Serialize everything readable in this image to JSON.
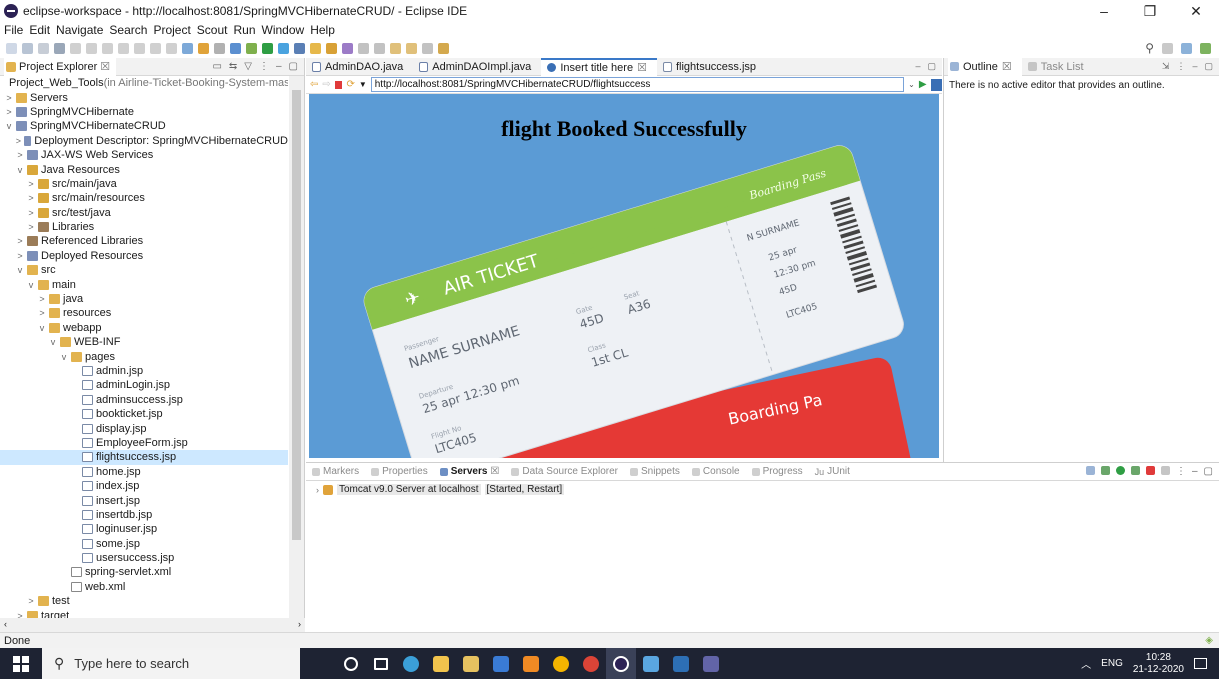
{
  "window": {
    "title": "eclipse-workspace - http://localhost:8081/SpringMVCHibernateCRUD/ - Eclipse IDE",
    "minimize": "–",
    "maximize": "❐",
    "close": "✕"
  },
  "menu": [
    "File",
    "Edit",
    "Navigate",
    "Search",
    "Project",
    "Scout",
    "Run",
    "Window",
    "Help"
  ],
  "explorer": {
    "tab_label": "Project Explorer",
    "tab_close": "☒",
    "items": [
      {
        "indent": 0,
        "twisty": "",
        "icon": "web-tools-icon",
        "label": "Project_Web_Tools",
        "suffix": " (in Airline-Ticket-Booking-System-maste"
      },
      {
        "indent": 0,
        "twisty": ">",
        "icon": "folder-icon",
        "label": "Servers",
        "suffix": ""
      },
      {
        "indent": 0,
        "twisty": ">",
        "icon": "project-icon",
        "label": "SpringMVCHibernate",
        "suffix": ""
      },
      {
        "indent": 0,
        "twisty": "v",
        "icon": "project-icon",
        "label": "SpringMVCHibernateCRUD",
        "suffix": ""
      },
      {
        "indent": 1,
        "twisty": ">",
        "icon": "descriptor-icon",
        "label": "Deployment Descriptor: SpringMVCHibernateCRUD",
        "suffix": ""
      },
      {
        "indent": 1,
        "twisty": ">",
        "icon": "webservices-icon",
        "label": "JAX-WS Web Services",
        "suffix": ""
      },
      {
        "indent": 1,
        "twisty": "v",
        "icon": "java-resources-icon",
        "label": "Java Resources",
        "suffix": ""
      },
      {
        "indent": 2,
        "twisty": ">",
        "icon": "source-folder-icon",
        "label": "src/main/java",
        "suffix": ""
      },
      {
        "indent": 2,
        "twisty": ">",
        "icon": "source-folder-icon",
        "label": "src/main/resources",
        "suffix": ""
      },
      {
        "indent": 2,
        "twisty": ">",
        "icon": "source-folder-icon",
        "label": "src/test/java",
        "suffix": ""
      },
      {
        "indent": 2,
        "twisty": ">",
        "icon": "library-icon",
        "label": "Libraries",
        "suffix": ""
      },
      {
        "indent": 1,
        "twisty": ">",
        "icon": "library-icon",
        "label": "Referenced Libraries",
        "suffix": ""
      },
      {
        "indent": 1,
        "twisty": ">",
        "icon": "deployed-icon",
        "label": "Deployed Resources",
        "suffix": ""
      },
      {
        "indent": 1,
        "twisty": "v",
        "icon": "folder-icon",
        "label": "src",
        "suffix": ""
      },
      {
        "indent": 2,
        "twisty": "v",
        "icon": "folder-icon",
        "label": "main",
        "suffix": ""
      },
      {
        "indent": 3,
        "twisty": ">",
        "icon": "folder-icon",
        "label": "java",
        "suffix": ""
      },
      {
        "indent": 3,
        "twisty": ">",
        "icon": "folder-icon",
        "label": "resources",
        "suffix": ""
      },
      {
        "indent": 3,
        "twisty": "v",
        "icon": "folder-icon",
        "label": "webapp",
        "suffix": ""
      },
      {
        "indent": 4,
        "twisty": "v",
        "icon": "folder-icon",
        "label": "WEB-INF",
        "suffix": ""
      },
      {
        "indent": 5,
        "twisty": "v",
        "icon": "folder-icon",
        "label": "pages",
        "suffix": ""
      },
      {
        "indent": 6,
        "twisty": "",
        "icon": "file-icon",
        "label": "admin.jsp",
        "suffix": ""
      },
      {
        "indent": 6,
        "twisty": "",
        "icon": "file-icon",
        "label": "adminLogin.jsp",
        "suffix": ""
      },
      {
        "indent": 6,
        "twisty": "",
        "icon": "file-icon",
        "label": "adminsuccess.jsp",
        "suffix": ""
      },
      {
        "indent": 6,
        "twisty": "",
        "icon": "file-icon",
        "label": "bookticket.jsp",
        "suffix": ""
      },
      {
        "indent": 6,
        "twisty": "",
        "icon": "file-icon",
        "label": "display.jsp",
        "suffix": ""
      },
      {
        "indent": 6,
        "twisty": "",
        "icon": "file-icon",
        "label": "EmployeeForm.jsp",
        "suffix": ""
      },
      {
        "indent": 6,
        "twisty": "",
        "icon": "file-icon",
        "label": "flightsuccess.jsp",
        "suffix": "",
        "selected": true
      },
      {
        "indent": 6,
        "twisty": "",
        "icon": "file-icon",
        "label": "home.jsp",
        "suffix": ""
      },
      {
        "indent": 6,
        "twisty": "",
        "icon": "file-icon",
        "label": "index.jsp",
        "suffix": ""
      },
      {
        "indent": 6,
        "twisty": "",
        "icon": "file-icon",
        "label": "insert.jsp",
        "suffix": ""
      },
      {
        "indent": 6,
        "twisty": "",
        "icon": "file-icon",
        "label": "insertdb.jsp",
        "suffix": ""
      },
      {
        "indent": 6,
        "twisty": "",
        "icon": "file-icon",
        "label": "loginuser.jsp",
        "suffix": ""
      },
      {
        "indent": 6,
        "twisty": "",
        "icon": "file-icon",
        "label": "some.jsp",
        "suffix": ""
      },
      {
        "indent": 6,
        "twisty": "",
        "icon": "file-icon",
        "label": "usersuccess.jsp",
        "suffix": ""
      },
      {
        "indent": 5,
        "twisty": "",
        "icon": "xml-icon",
        "label": "spring-servlet.xml",
        "suffix": ""
      },
      {
        "indent": 5,
        "twisty": "",
        "icon": "xml-icon",
        "label": "web.xml",
        "suffix": ""
      },
      {
        "indent": 2,
        "twisty": ">",
        "icon": "folder-icon",
        "label": "test",
        "suffix": ""
      },
      {
        "indent": 1,
        "twisty": ">",
        "icon": "folder-icon",
        "label": "target",
        "suffix": ""
      }
    ]
  },
  "editor": {
    "tabs": [
      {
        "label": "AdminDAO.java",
        "icon": "java-file-icon",
        "active": false
      },
      {
        "label": "AdminDAOImpl.java",
        "icon": "java-file-icon",
        "active": false
      },
      {
        "label": "Insert title here",
        "icon": "browser-icon",
        "active": true,
        "close": "☒"
      },
      {
        "label": "flightsuccess.jsp",
        "icon": "jsp-file-icon",
        "active": false
      }
    ],
    "url": "http://localhost:8081/SpringMVCHibernateCRUD/flightsuccess",
    "page_heading": "flight Booked Successfully"
  },
  "ticket": {
    "header": "AIR TICKET",
    "boarding_pass": "Boarding Pass",
    "passenger_caption": "Passenger",
    "name": "NAME SURNAME",
    "gate_caption": "Gate",
    "gate": "45D",
    "seat_caption": "Seat",
    "seat": "A36",
    "departure_caption": "Departure",
    "departure": "25 apr 12:30 pm",
    "class_caption": "Class",
    "class": "1st CL",
    "flight_caption": "Flight No",
    "flight": "LTC405",
    "stub_name": "N SURNAME",
    "stub_date": "25 apr",
    "stub_time": "12:30 pm",
    "stub_gate": "45D",
    "stub_flight": "LTC405",
    "second_ticket_label": "Boarding Pa",
    "colors": {
      "green": "#8bc34a",
      "red": "#e53935",
      "sky": "#5b9bd5"
    }
  },
  "outline": {
    "tabs": [
      "Outline",
      "Task List"
    ],
    "message": "There is no active editor that provides an outline."
  },
  "bottom": {
    "tabs": [
      "Markers",
      "Properties",
      "Servers",
      "Data Source Explorer",
      "Snippets",
      "Console",
      "Progress",
      "JUnit"
    ],
    "active_tab": "Servers",
    "server": "Tomcat v9.0 Server at localhost",
    "server_state": "[Started, Restart]"
  },
  "status": {
    "text": "Done"
  },
  "taskbar": {
    "search_placeholder": "Type here to search",
    "lang": "ENG",
    "time": "10:28",
    "date": "21-12-2020"
  }
}
